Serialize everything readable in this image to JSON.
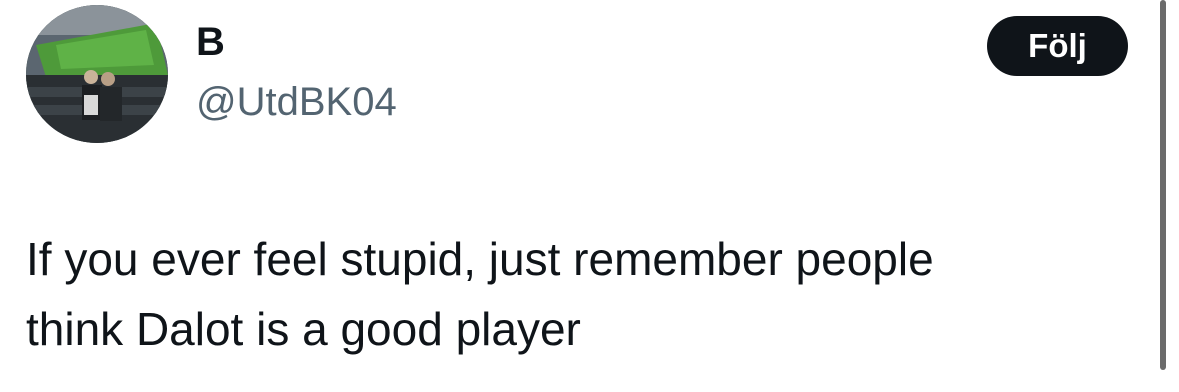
{
  "user": {
    "display_name": "B",
    "handle": "@UtdBK04",
    "avatar_icon": "stadium-photo-avatar"
  },
  "follow_button": {
    "label": "Följ"
  },
  "tweet": {
    "text_line1": "If you ever feel stupid, just remember people",
    "text_line2": "think Dalot is a good player"
  },
  "colors": {
    "text_primary": "#0f1419",
    "text_secondary": "#536471",
    "button_bg": "#0f1419",
    "button_text": "#ffffff"
  }
}
